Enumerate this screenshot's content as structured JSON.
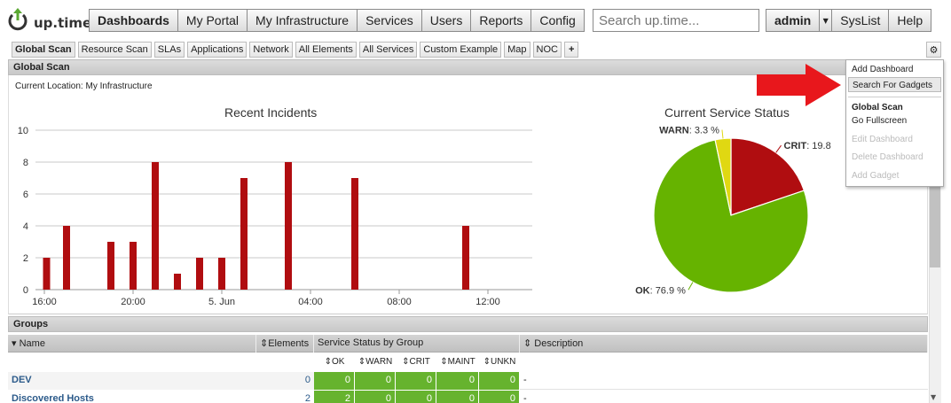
{
  "app": {
    "logo_text": "up.time",
    "brand_color": "#5aa832"
  },
  "nav": {
    "items": [
      "Dashboards",
      "My Portal",
      "My Infrastructure",
      "Services",
      "Users",
      "Reports",
      "Config"
    ],
    "search_placeholder": "Search up.time...",
    "user": "admin",
    "syslist": "SysList",
    "help": "Help"
  },
  "tabs": [
    "Global Scan",
    "Resource Scan",
    "SLAs",
    "Applications",
    "Network",
    "All Elements",
    "All Services",
    "Custom Example",
    "Map",
    "NOC",
    "+"
  ],
  "panel": {
    "title": "Global Scan",
    "location": "Current Location: My Infrastructure"
  },
  "incidents_chart": {
    "title": "Recent Incidents",
    "chart_data": {
      "type": "bar",
      "x_ticks": [
        "16:00",
        "20:00",
        "5. Jun",
        "04:00",
        "08:00",
        "12:00"
      ],
      "y_ticks": [
        "0",
        "2",
        "4",
        "6",
        "8",
        "10"
      ],
      "ylim": [
        0,
        10
      ],
      "bar_color": "#b00d10",
      "bars": [
        {
          "x": 16.1,
          "value": 2
        },
        {
          "x": 17.0,
          "value": 4
        },
        {
          "x": 19.0,
          "value": 3
        },
        {
          "x": 20.0,
          "value": 3
        },
        {
          "x": 21.0,
          "value": 8
        },
        {
          "x": 22.0,
          "value": 1
        },
        {
          "x": 23.0,
          "value": 2
        },
        {
          "x": 24.0,
          "value": 2
        },
        {
          "x": 25.0,
          "value": 7
        },
        {
          "x": 27.0,
          "value": 8
        },
        {
          "x": 30.0,
          "value": 7
        },
        {
          "x": 35.0,
          "value": 4
        }
      ],
      "x_range": [
        15.6,
        38.0
      ]
    }
  },
  "status_chart": {
    "title": "Current Service Status",
    "chart_data": {
      "type": "pie",
      "slices": [
        {
          "name": "CRIT",
          "value": 19.8,
          "color": "#b00d10",
          "label_text": "19.8"
        },
        {
          "name": "OK",
          "value": 76.9,
          "color": "#66b300",
          "label_text": "76.9 %"
        },
        {
          "name": "WARN",
          "value": 3.3,
          "color": "#e0d812",
          "label_text": "3.3 %"
        }
      ]
    }
  },
  "groups": {
    "title": "Groups",
    "headers": {
      "name": "Name",
      "elements": "Elements",
      "status": "Service Status by Group",
      "description": "Description"
    },
    "status_cols": [
      "OK",
      "WARN",
      "CRIT",
      "MAINT",
      "UNKN"
    ],
    "rows": [
      {
        "name": "DEV",
        "elements": "0",
        "status": [
          "0",
          "0",
          "0",
          "0",
          "0"
        ],
        "description": "-"
      },
      {
        "name": "Discovered Hosts",
        "elements": "2",
        "status": [
          "2",
          "0",
          "0",
          "0",
          "0"
        ],
        "description": "-"
      }
    ]
  },
  "menu": {
    "items": [
      {
        "label": "Add Dashboard",
        "enabled": true
      },
      {
        "label": "Search For Gadgets",
        "enabled": true,
        "highlighted": true
      }
    ],
    "section": "Global Scan",
    "section_items": [
      {
        "label": "Go Fullscreen",
        "enabled": true
      },
      {
        "label": "Edit Dashboard",
        "enabled": false
      },
      {
        "label": "Delete Dashboard",
        "enabled": false
      },
      {
        "label": "Add Gadget",
        "enabled": false
      }
    ]
  },
  "colors": {
    "arrow": "#e8171c",
    "ok": "#66b32e"
  },
  "sort_icons": {
    "asc": "sort-icon",
    "desc": "sort-desc-icon"
  }
}
